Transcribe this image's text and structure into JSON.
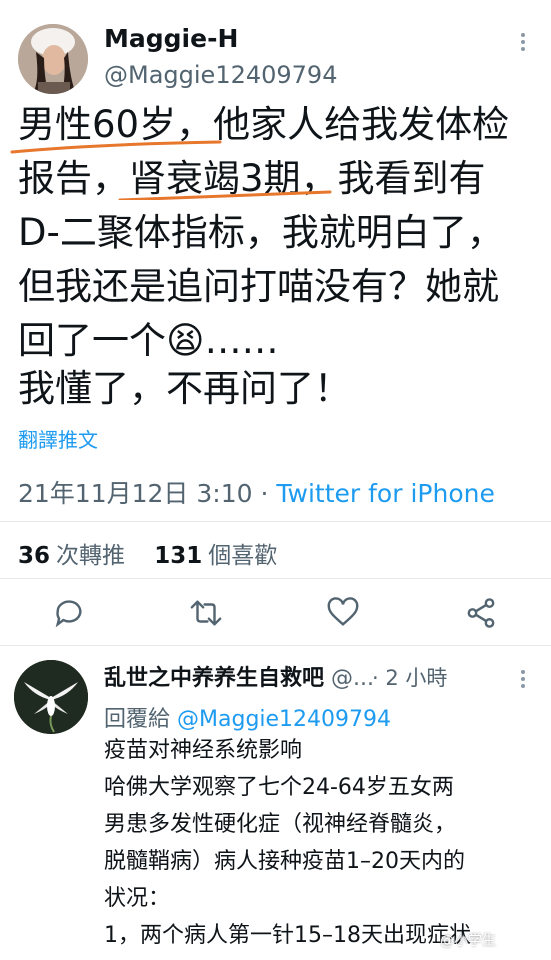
{
  "tweet": {
    "author_name": "Maggie-H",
    "author_handle": "@Maggie12409794",
    "lines": [
      "男性60岁，他家人给我发体检",
      "报告，肾衰竭3期，我看到有",
      "D-二聚体指标，我就明白了，",
      "但我还是追问打喵没有？她就",
      "回了一个😫……",
      "我懂了，不再问了！"
    ],
    "translate_link": "翻譯推文",
    "timestamp": "21年11月12日 3:10",
    "separator": "·",
    "source": "Twitter for iPhone",
    "retweets_count": "36",
    "retweets_label": "次轉推",
    "likes_count": "131",
    "likes_label": "個喜歡"
  },
  "reply": {
    "author_name": "乱世之中养养生自救吧",
    "author_handle_truncated": "@...",
    "time": "· 2 小時",
    "reply_to_label": "回覆給",
    "reply_to_handle": "@Maggie12409794",
    "lines": [
      "疫苗对神经系统影响",
      "哈佛大学观察了七个24-64岁五女两",
      "男患多发性硬化症（视神经脊髓炎，",
      "脱髓鞘病）病人接种疫苗1–20天内的",
      "状况：",
      "1，两个病人第一针15–18天出现症状"
    ]
  },
  "watermark": "@小学生",
  "icons": {
    "reply": "reply-icon",
    "retweet": "retweet-icon",
    "like": "heart-icon",
    "share": "share-icon",
    "more": "more-icon"
  },
  "colors": {
    "link": "#1d9bf0",
    "underline": "#e7772d",
    "muted": "#536471"
  }
}
